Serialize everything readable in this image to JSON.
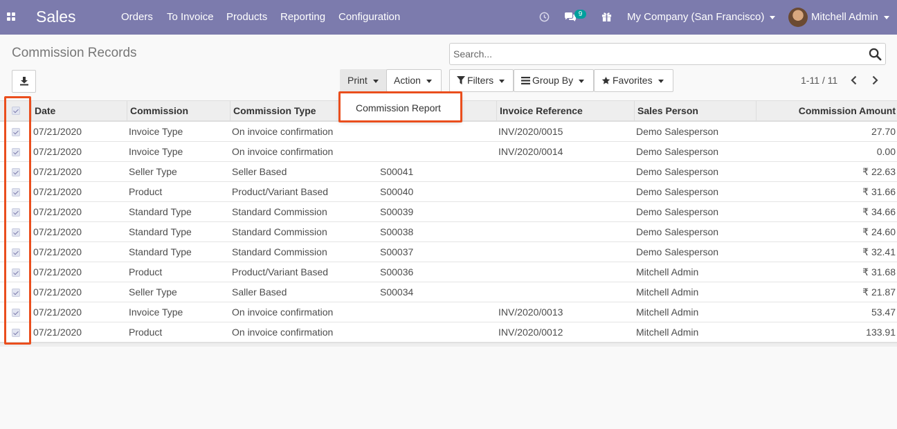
{
  "navbar": {
    "app_name": "Sales",
    "menus": [
      "Orders",
      "To Invoice",
      "Products",
      "Reporting",
      "Configuration"
    ],
    "chat_count": "9",
    "company": "My Company (San Francisco)",
    "user": "Mitchell Admin",
    "icons": [
      "apps-grid-icon",
      "clock-icon",
      "chat-icon",
      "gift-icon"
    ],
    "color": "#7c7bad"
  },
  "control_panel": {
    "title": "Commission Records",
    "search_placeholder": "Search...",
    "print_label": "Print",
    "action_label": "Action",
    "filters_label": "Filters",
    "group_by_label": "Group By",
    "favorites_label": "Favorites",
    "pager": "1-11 / 11"
  },
  "print_menu": {
    "items": [
      "Commission Report"
    ]
  },
  "table": {
    "columns": [
      "Date",
      "Commission",
      "Commission Type",
      "Invoice Reference",
      "Sales Person",
      "Commission Amount"
    ],
    "rows": [
      {
        "date": "07/21/2020",
        "commission": "Invoice Type",
        "type": "On invoice confirmation",
        "order": "",
        "invoice": "INV/2020/0015",
        "salesperson": "Demo Salesperson",
        "amount": "27.70"
      },
      {
        "date": "07/21/2020",
        "commission": "Invoice Type",
        "type": "On invoice confirmation",
        "order": "",
        "invoice": "INV/2020/0014",
        "salesperson": "Demo Salesperson",
        "amount": "0.00"
      },
      {
        "date": "07/21/2020",
        "commission": "Seller Type",
        "type": "Seller Based",
        "order": "S00041",
        "invoice": "",
        "salesperson": "Demo Salesperson",
        "amount": "₹ 22.63"
      },
      {
        "date": "07/21/2020",
        "commission": "Product",
        "type": "Product/Variant Based",
        "order": "S00040",
        "invoice": "",
        "salesperson": "Demo Salesperson",
        "amount": "₹ 31.66"
      },
      {
        "date": "07/21/2020",
        "commission": "Standard Type",
        "type": "Standard Commission",
        "order": "S00039",
        "invoice": "",
        "salesperson": "Demo Salesperson",
        "amount": "₹ 34.66"
      },
      {
        "date": "07/21/2020",
        "commission": "Standard Type",
        "type": "Standard Commission",
        "order": "S00038",
        "invoice": "",
        "salesperson": "Demo Salesperson",
        "amount": "₹ 24.60"
      },
      {
        "date": "07/21/2020",
        "commission": "Standard Type",
        "type": "Standard Commission",
        "order": "S00037",
        "invoice": "",
        "salesperson": "Demo Salesperson",
        "amount": "₹ 32.41"
      },
      {
        "date": "07/21/2020",
        "commission": "Product",
        "type": "Product/Variant Based",
        "order": "S00036",
        "invoice": "",
        "salesperson": "Mitchell Admin",
        "amount": "₹ 31.68"
      },
      {
        "date": "07/21/2020",
        "commission": "Seller Type",
        "type": "Saller Based",
        "order": "S00034",
        "invoice": "",
        "salesperson": "Mitchell Admin",
        "amount": "₹ 21.87"
      },
      {
        "date": "07/21/2020",
        "commission": "Invoice Type",
        "type": "On invoice confirmation",
        "order": "",
        "invoice": "INV/2020/0013",
        "salesperson": "Mitchell Admin",
        "amount": "53.47"
      },
      {
        "date": "07/21/2020",
        "commission": "Product",
        "type": "On invoice confirmation",
        "order": "",
        "invoice": "INV/2020/0012",
        "salesperson": "Mitchell Admin",
        "amount": "133.91"
      }
    ]
  }
}
